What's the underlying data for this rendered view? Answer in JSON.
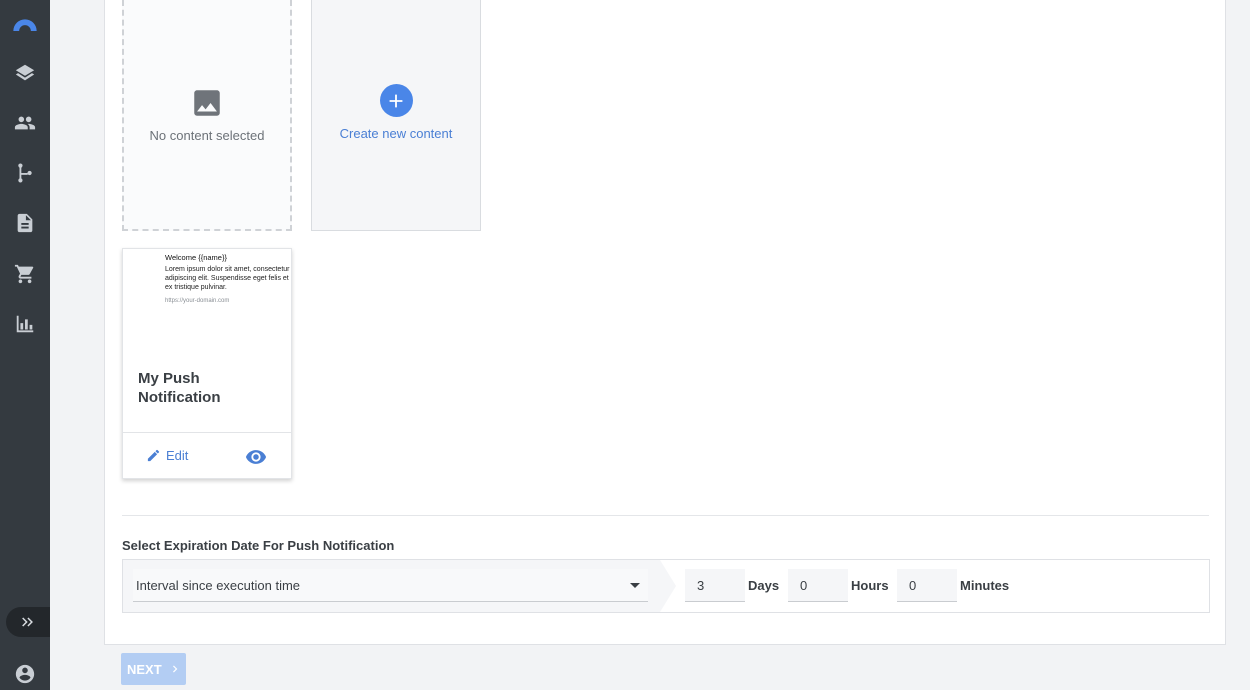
{
  "sidebar": {
    "items": [
      {
        "icon": "logo-arc-icon"
      },
      {
        "icon": "layers-icon"
      },
      {
        "icon": "people-icon"
      },
      {
        "icon": "journey-branch-icon"
      },
      {
        "icon": "document-icon"
      },
      {
        "icon": "cart-icon"
      },
      {
        "icon": "bar-chart-icon"
      }
    ],
    "expand_icon": "double-chevron-right-icon",
    "user_icon": "account-icon"
  },
  "content": {
    "empty_card_label": "No content selected",
    "create_card_label": "Create new content",
    "push_card": {
      "preview_title": "Welcome {{name}}",
      "preview_body": "Lorem ipsum dolor sit amet, consectetur adipiscing elit. Suspendisse eget felis et ex tristique pulvinar.",
      "preview_url": "https://your-domain.com",
      "title": "My Push Notification",
      "edit_label": "Edit"
    }
  },
  "expiration": {
    "label": "Select Expiration Date For Push Notification",
    "mode": "Interval since execution time",
    "days_value": "3",
    "days_label": "Days",
    "hours_value": "0",
    "hours_label": "Hours",
    "minutes_value": "0",
    "minutes_label": "Minutes"
  },
  "footer": {
    "next_label": "NEXT"
  },
  "colors": {
    "sidebar_bg": "#343a40",
    "accent": "#4a86e8",
    "next_disabled": "#b3cdf3"
  }
}
